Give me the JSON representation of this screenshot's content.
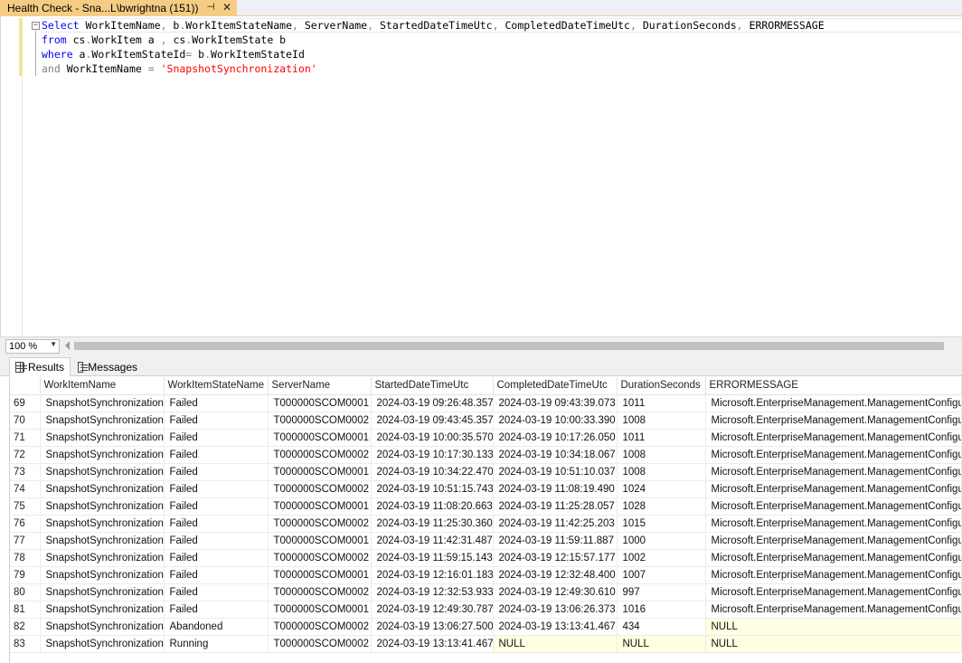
{
  "tab": {
    "title": "Health Check - Sna...L\\bwrightna (151))",
    "pin_glyph": "⊣",
    "close_glyph": "✕"
  },
  "editor": {
    "collapse_glyph": "−",
    "lines": [
      [
        {
          "t": "Select",
          "c": "kw"
        },
        {
          "t": " WorkItemName",
          "c": ""
        },
        {
          "t": ",",
          "c": "op"
        },
        {
          "t": " b",
          "c": ""
        },
        {
          "t": ".",
          "c": "op"
        },
        {
          "t": "WorkItemStateName",
          "c": ""
        },
        {
          "t": ",",
          "c": "op"
        },
        {
          "t": " ServerName",
          "c": ""
        },
        {
          "t": ",",
          "c": "op"
        },
        {
          "t": " StartedDateTimeUtc",
          "c": ""
        },
        {
          "t": ",",
          "c": "op"
        },
        {
          "t": " CompletedDateTimeUtc",
          "c": ""
        },
        {
          "t": ",",
          "c": "op"
        },
        {
          "t": " DurationSeconds",
          "c": ""
        },
        {
          "t": ",",
          "c": "op"
        },
        {
          "t": " ERRORMESSAGE",
          "c": ""
        }
      ],
      [
        {
          "t": "from",
          "c": "kw"
        },
        {
          "t": " cs",
          "c": ""
        },
        {
          "t": ".",
          "c": "op"
        },
        {
          "t": "WorkItem a ",
          "c": ""
        },
        {
          "t": ",",
          "c": "op"
        },
        {
          "t": " cs",
          "c": ""
        },
        {
          "t": ".",
          "c": "op"
        },
        {
          "t": "WorkItemState b",
          "c": ""
        }
      ],
      [
        {
          "t": "where",
          "c": "kw"
        },
        {
          "t": " a",
          "c": ""
        },
        {
          "t": ".",
          "c": "op"
        },
        {
          "t": "WorkItemStateId",
          "c": ""
        },
        {
          "t": "=",
          "c": "op"
        },
        {
          "t": " b",
          "c": ""
        },
        {
          "t": ".",
          "c": "op"
        },
        {
          "t": "WorkItemStateId",
          "c": ""
        }
      ],
      [
        {
          "t": "and",
          "c": "op"
        },
        {
          "t": " WorkItemName ",
          "c": ""
        },
        {
          "t": "=",
          "c": "op"
        },
        {
          "t": " ",
          "c": ""
        },
        {
          "t": "'SnapshotSynchronization'",
          "c": "str"
        }
      ]
    ]
  },
  "zoom": {
    "value": "100 %",
    "arrow_glyph": "▼"
  },
  "results_tabs": {
    "results_label": "Results",
    "messages_label": "Messages"
  },
  "grid": {
    "columns": [
      "",
      "WorkItemName",
      "WorkItemStateName",
      "ServerName",
      "StartedDateTimeUtc",
      "CompletedDateTimeUtc",
      "DurationSeconds",
      "ERRORMESSAGE"
    ],
    "rows": [
      [
        "69",
        "SnapshotSynchronization",
        "Failed",
        "T000000SCOM0001",
        "2024-03-19 09:26:48.357",
        "2024-03-19 09:43:39.073",
        "1011",
        "Microsoft.EnterpriseManagement.ManagementConfigu..."
      ],
      [
        "70",
        "SnapshotSynchronization",
        "Failed",
        "T000000SCOM0002",
        "2024-03-19 09:43:45.357",
        "2024-03-19 10:00:33.390",
        "1008",
        "Microsoft.EnterpriseManagement.ManagementConfigu..."
      ],
      [
        "71",
        "SnapshotSynchronization",
        "Failed",
        "T000000SCOM0001",
        "2024-03-19 10:00:35.570",
        "2024-03-19 10:17:26.050",
        "1011",
        "Microsoft.EnterpriseManagement.ManagementConfigu..."
      ],
      [
        "72",
        "SnapshotSynchronization",
        "Failed",
        "T000000SCOM0002",
        "2024-03-19 10:17:30.133",
        "2024-03-19 10:34:18.067",
        "1008",
        "Microsoft.EnterpriseManagement.ManagementConfigu..."
      ],
      [
        "73",
        "SnapshotSynchronization",
        "Failed",
        "T000000SCOM0001",
        "2024-03-19 10:34:22.470",
        "2024-03-19 10:51:10.037",
        "1008",
        "Microsoft.EnterpriseManagement.ManagementConfigu..."
      ],
      [
        "74",
        "SnapshotSynchronization",
        "Failed",
        "T000000SCOM0002",
        "2024-03-19 10:51:15.743",
        "2024-03-19 11:08:19.490",
        "1024",
        "Microsoft.EnterpriseManagement.ManagementConfigu..."
      ],
      [
        "75",
        "SnapshotSynchronization",
        "Failed",
        "T000000SCOM0001",
        "2024-03-19 11:08:20.663",
        "2024-03-19 11:25:28.057",
        "1028",
        "Microsoft.EnterpriseManagement.ManagementConfigu..."
      ],
      [
        "76",
        "SnapshotSynchronization",
        "Failed",
        "T000000SCOM0002",
        "2024-03-19 11:25:30.360",
        "2024-03-19 11:42:25.203",
        "1015",
        "Microsoft.EnterpriseManagement.ManagementConfigu..."
      ],
      [
        "77",
        "SnapshotSynchronization",
        "Failed",
        "T000000SCOM0001",
        "2024-03-19 11:42:31.487",
        "2024-03-19 11:59:11.887",
        "1000",
        "Microsoft.EnterpriseManagement.ManagementConfigu..."
      ],
      [
        "78",
        "SnapshotSynchronization",
        "Failed",
        "T000000SCOM0002",
        "2024-03-19 11:59:15.143",
        "2024-03-19 12:15:57.177",
        "1002",
        "Microsoft.EnterpriseManagement.ManagementConfigu..."
      ],
      [
        "79",
        "SnapshotSynchronization",
        "Failed",
        "T000000SCOM0001",
        "2024-03-19 12:16:01.183",
        "2024-03-19 12:32:48.400",
        "1007",
        "Microsoft.EnterpriseManagement.ManagementConfigu..."
      ],
      [
        "80",
        "SnapshotSynchronization",
        "Failed",
        "T000000SCOM0002",
        "2024-03-19 12:32:53.933",
        "2024-03-19 12:49:30.610",
        "997",
        "Microsoft.EnterpriseManagement.ManagementConfigu..."
      ],
      [
        "81",
        "SnapshotSynchronization",
        "Failed",
        "T000000SCOM0001",
        "2024-03-19 12:49:30.787",
        "2024-03-19 13:06:26.373",
        "1016",
        "Microsoft.EnterpriseManagement.ManagementConfigu..."
      ],
      [
        "82",
        "SnapshotSynchronization",
        "Abandoned",
        "T000000SCOM0002",
        "2024-03-19 13:06:27.500",
        "2024-03-19 13:13:41.467",
        "434",
        "NULL"
      ],
      [
        "83",
        "SnapshotSynchronization",
        "Running",
        "T000000SCOM0002",
        "2024-03-19 13:13:41.467",
        "NULL",
        "NULL",
        "NULL"
      ]
    ]
  }
}
